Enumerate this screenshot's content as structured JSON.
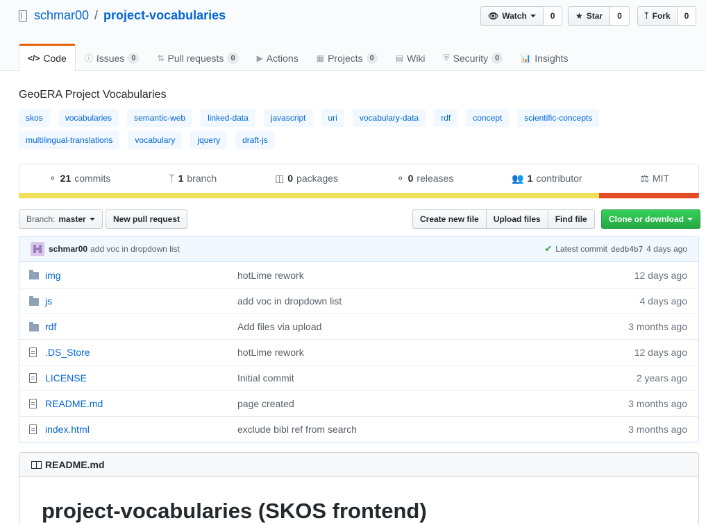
{
  "repo": {
    "owner": "schmar00",
    "separator": "/",
    "name": "project-vocabularies"
  },
  "actions": {
    "watch": {
      "label": "Watch",
      "count": "0"
    },
    "star": {
      "label": "Star",
      "count": "0"
    },
    "fork": {
      "label": "Fork",
      "count": "0"
    }
  },
  "tabs": [
    {
      "label": "Code",
      "icon": "code-icon"
    },
    {
      "label": "Issues",
      "count": "0",
      "icon": "issue-icon"
    },
    {
      "label": "Pull requests",
      "count": "0",
      "icon": "pull-request-icon"
    },
    {
      "label": "Actions",
      "icon": "play-icon"
    },
    {
      "label": "Projects",
      "count": "0",
      "icon": "project-icon"
    },
    {
      "label": "Wiki",
      "icon": "book-icon"
    },
    {
      "label": "Security",
      "count": "0",
      "icon": "shield-icon"
    },
    {
      "label": "Insights",
      "icon": "graph-icon"
    }
  ],
  "description": "GeoERA Project Vocabularies",
  "topics": [
    "skos",
    "vocabularies",
    "semantic-web",
    "linked-data",
    "javascript",
    "uri",
    "vocabulary-data",
    "rdf",
    "concept",
    "scientific-concepts",
    "multilingual-translations",
    "vocabulary",
    "jquery",
    "draft-js"
  ],
  "summary": {
    "commits": {
      "num": "21",
      "label": "commits"
    },
    "branch": {
      "num": "1",
      "label": "branch"
    },
    "packages": {
      "num": "0",
      "label": "packages"
    },
    "releases": {
      "num": "0",
      "label": "releases"
    },
    "contributor": {
      "num": "1",
      "label": "contributor"
    },
    "license": "MIT"
  },
  "languages": [
    {
      "color": "#f1e05a",
      "percent": 85.3
    },
    {
      "color": "#e34c26",
      "percent": 14.7
    }
  ],
  "filenav": {
    "branch_prefix": "Branch:",
    "branch_name": "master",
    "new_pr": "New pull request",
    "create_file": "Create new file",
    "upload_files": "Upload files",
    "find_file": "Find file",
    "clone": "Clone or download"
  },
  "latest_commit": {
    "author": "schmar00",
    "message": "add voc in dropdown list",
    "label": "Latest commit",
    "sha": "dedb4b7",
    "age": "4 days ago"
  },
  "files": [
    {
      "name": "img",
      "type": "dir",
      "message": "hotLime rework",
      "age": "12 days ago"
    },
    {
      "name": "js",
      "type": "dir",
      "message": "add voc in dropdown list",
      "age": "4 days ago"
    },
    {
      "name": "rdf",
      "type": "dir",
      "message": "Add files via upload",
      "age": "3 months ago"
    },
    {
      "name": ".DS_Store",
      "type": "file",
      "message": "hotLime rework",
      "age": "12 days ago"
    },
    {
      "name": "LICENSE",
      "type": "file",
      "message": "Initial commit",
      "age": "2 years ago"
    },
    {
      "name": "README.md",
      "type": "file",
      "message": "page created",
      "age": "3 months ago"
    },
    {
      "name": "index.html",
      "type": "file",
      "message": "exclude bibl ref from search",
      "age": "3 months ago"
    }
  ],
  "readme": {
    "filename": "README.md",
    "heading": "project-vocabularies (SKOS frontend)"
  }
}
